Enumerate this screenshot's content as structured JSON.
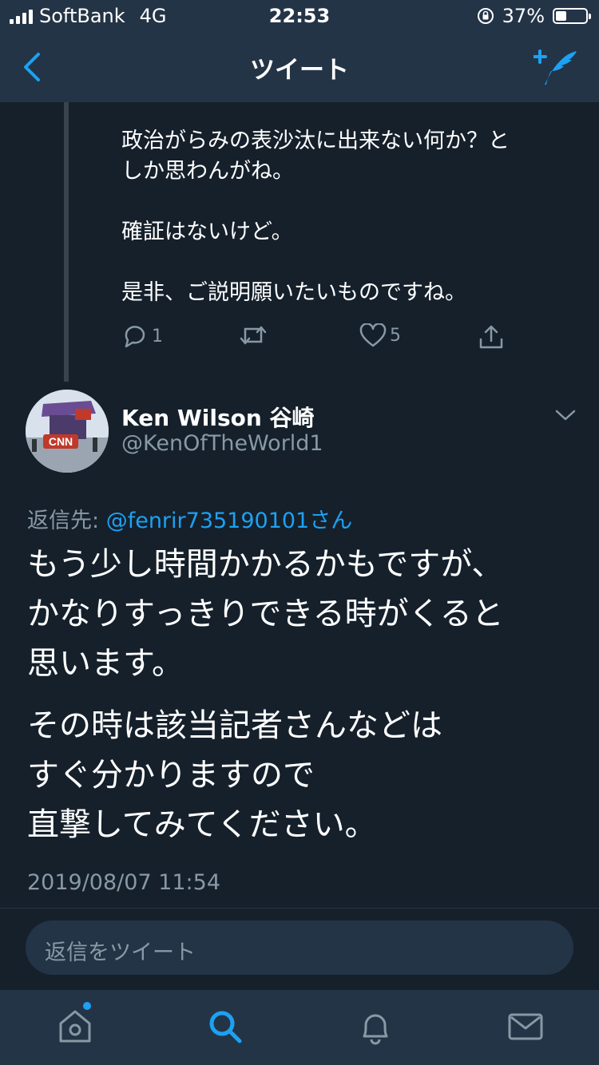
{
  "status_bar": {
    "carrier": "SoftBank",
    "network": "4G",
    "time": "22:53",
    "battery": "37%",
    "battery_level": 0.37
  },
  "nav": {
    "title": "ツイート"
  },
  "previous_tweet": {
    "lines": [
      "政治がらみの表沙汰に出来ない何か？と",
      "しか思わんがね。",
      "",
      "確証はないけど。",
      "",
      "是非、ご説明願いたいものですね。"
    ],
    "reply_count": "1",
    "like_count": "5"
  },
  "tweet": {
    "display_name": "Ken Wilson 谷崎",
    "handle": "@KenOfTheWorld1",
    "reply_to_label": "返信先:",
    "reply_to_user": "@fenrir735190101さん",
    "text_para1": [
      "もう少し時間かかるかもですが、",
      "かなりすっきりできる時がくると",
      "思います。"
    ],
    "text_para2": [
      "その時は該当記者さんなどは",
      "すぐ分かりますので",
      "直撃してみてください。"
    ],
    "timestamp": "2019/08/07 11:54",
    "avatar_logo_text": "CNN"
  },
  "reply_bar": {
    "placeholder": "返信をツイート"
  },
  "tab_bar": {
    "items": [
      "home-icon",
      "search-icon",
      "notifications-icon",
      "messages-icon"
    ],
    "active": "search-icon"
  },
  "colors": {
    "background": "#15202b",
    "bar": "#243447",
    "accent": "#1da1f2",
    "secondary_text": "#8899a6"
  }
}
